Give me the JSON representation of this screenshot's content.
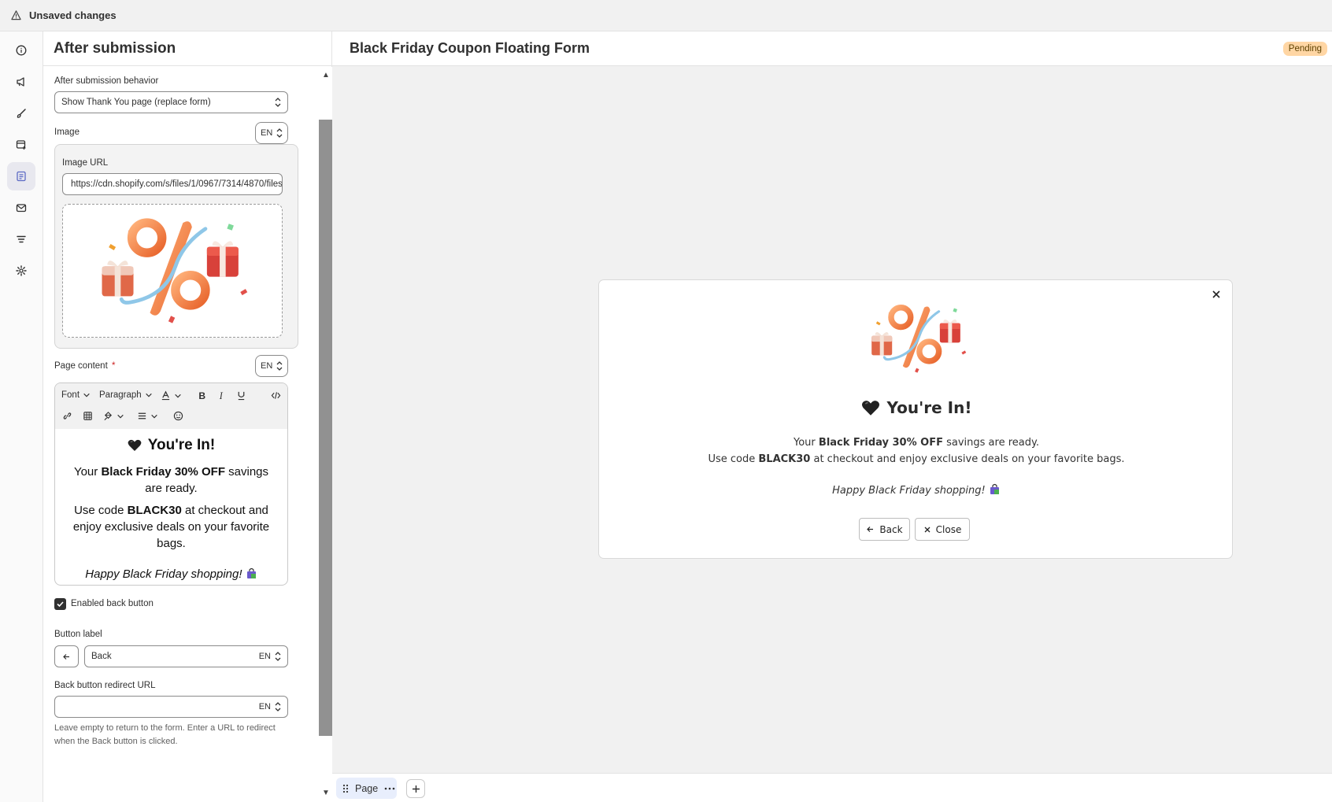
{
  "topbar": {
    "title": "Unsaved changes",
    "icon": "warning-icon"
  },
  "rail": {
    "items": [
      {
        "name": "info-icon"
      },
      {
        "name": "megaphone-icon"
      },
      {
        "name": "brush-icon"
      },
      {
        "name": "form-add-icon"
      },
      {
        "name": "after-submission-icon"
      },
      {
        "name": "email-icon"
      },
      {
        "name": "filter-icon"
      },
      {
        "name": "settings-icon"
      }
    ],
    "active": "after-submission-icon"
  },
  "panel": {
    "title": "After submission",
    "behavior_label": "After submission behavior",
    "behavior_value": "Show Thank You page (replace form)",
    "image_label": "Image",
    "lang": "EN",
    "image_url_label": "Image URL",
    "image_url_value": "https://cdn.shopify.com/s/files/1/0967/7314/4870/files",
    "page_content_label": "Page content",
    "required_mark": "*",
    "toolbar": {
      "font": "Font",
      "paragraph": "Paragraph"
    },
    "content": {
      "heading": "You're In!",
      "line1_pre": "Your ",
      "line1_bold": "Black Friday 30% OFF",
      "line1_post": " savings are ready.",
      "line2_pre": "Use code ",
      "line2_bold": "BLACK30",
      "line2_post": " at checkout and enjoy exclusive deals on your favorite bags.",
      "closing": "Happy Black Friday shopping!"
    },
    "enable_back_label": "Enabled back button",
    "enable_back_checked": true,
    "button_label_label": "Button label",
    "button_label_value": "Back",
    "redirect_label": "Back button redirect URL",
    "redirect_value": "",
    "redirect_hint": "Leave empty to return to the form. Enter a URL to redirect when the Back button is clicked."
  },
  "main": {
    "title": "Black Friday Coupon Floating Form",
    "status": "Pending",
    "status_color": "#ffd6a4",
    "preview": {
      "heading": "You're In!",
      "line1_pre": "Your ",
      "line1_bold": "Black Friday 30% OFF",
      "line1_post": " savings are ready.",
      "line2_pre": "Use code ",
      "line2_bold": "BLACK30",
      "line2_post": " at checkout and enjoy exclusive deals on your favorite bags.",
      "closing": "Happy Black Friday shopping!",
      "back_button": "Back",
      "close_button": "Close"
    },
    "page_tab": "Page"
  }
}
